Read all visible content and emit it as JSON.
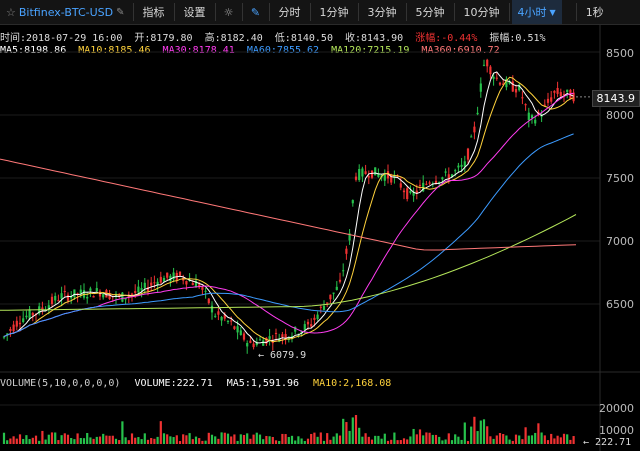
{
  "toolbar": {
    "symbol": "Bitfinex-BTC-USD",
    "indicator_label": "指标",
    "settings_label": "设置",
    "intervals": [
      "分时",
      "1分钟",
      "3分钟",
      "5分钟",
      "10分钟"
    ],
    "selected_interval": "4小时",
    "right_label": "1秒"
  },
  "info": {
    "time": "时间:2018-07-29 16:00",
    "open": "开:8179.80",
    "high": "高:8182.40",
    "low": "低:8140.50",
    "close": "收:8143.90",
    "change": "涨幅:-0.44%",
    "amplitude": "振幅:0.51%"
  },
  "ma": {
    "ma5": "MA5:8198.86",
    "ma10": "MA10:8185.46",
    "ma30": "MA30:8178.41",
    "ma60": "MA60:7855.62",
    "ma120": "MA120:7215.19",
    "ma360": "MA360:6910.72"
  },
  "volume": {
    "label": "VOLUME(5,10,0,0,0,0)",
    "value": "VOLUME:222.71",
    "ma5": "MA5:1,591.96",
    "ma10": "MA10:2,168.08",
    "last": "← 222.71"
  },
  "price_axis": {
    "ticks": [
      "8500",
      "8000",
      "7500",
      "7000",
      "6500"
    ],
    "current": "8143.9",
    "low_marker": "← 6079.9"
  },
  "volume_axis": {
    "ticks": [
      "20000",
      "10000"
    ]
  },
  "colors": {
    "ma5": "#ffffff",
    "ma10": "#ffd23c",
    "ma30": "#ff3cf0",
    "ma60": "#3c9bff",
    "ma120": "#b4e65a",
    "ma360": "#ff7878",
    "up": "#27c24c",
    "down": "#f03232",
    "change_down": "#f03232"
  }
}
